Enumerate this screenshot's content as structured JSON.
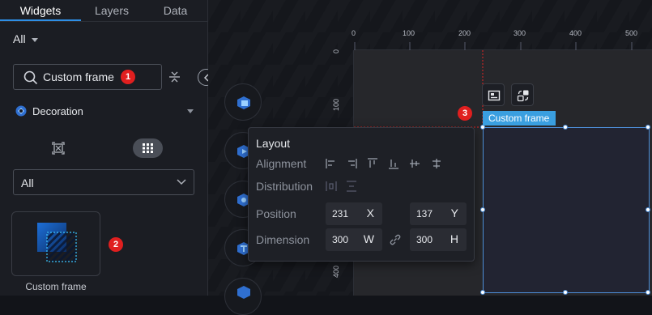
{
  "left_panel": {
    "tabs": [
      {
        "label": "Widgets"
      },
      {
        "label": "Layers"
      },
      {
        "label": "Data"
      }
    ],
    "filter_label": "All",
    "search": {
      "value": "Custom frame"
    },
    "category": "Decoration",
    "type_select": "All",
    "widget": {
      "label": "Custom frame"
    }
  },
  "badges": [
    "1",
    "2",
    "3"
  ],
  "ruler": {
    "top_ticks": [
      "0",
      "100",
      "200",
      "300",
      "400",
      "500"
    ],
    "left_ticks": [
      "0",
      "100",
      "400"
    ]
  },
  "frame_tag": "Custom frame",
  "layout_panel": {
    "title": "Layout",
    "alignment_label": "Alignment",
    "distribution_label": "Distribution",
    "position_label": "Position",
    "dimension_label": "Dimension",
    "x_value": "231",
    "x_unit": "X",
    "y_value": "137",
    "y_unit": "Y",
    "w_value": "300",
    "w_unit": "W",
    "h_value": "300",
    "h_unit": "H"
  },
  "colors": {
    "accent": "#2e8fe6",
    "badge": "#e01f1f",
    "selection": "#4e8fd8"
  }
}
